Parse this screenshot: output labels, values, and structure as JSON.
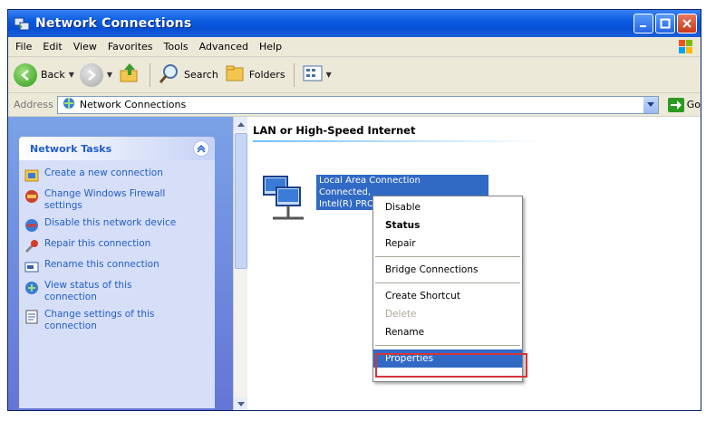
{
  "window": {
    "title": "Network Connections"
  },
  "menubar": {
    "items": [
      "File",
      "Edit",
      "View",
      "Favorites",
      "Tools",
      "Advanced",
      "Help"
    ]
  },
  "toolbar": {
    "back_label": "Back",
    "search_label": "Search",
    "folders_label": "Folders"
  },
  "addressbar": {
    "label": "Address",
    "value": "Network Connections",
    "go_label": "Go"
  },
  "tasks": {
    "title": "Network Tasks",
    "items": [
      {
        "label": "Create a new connection",
        "icon": "new-connection-icon"
      },
      {
        "label": "Change Windows Firewall settings",
        "icon": "firewall-icon"
      },
      {
        "label": "Disable this network device",
        "icon": "disable-device-icon"
      },
      {
        "label": "Repair this connection",
        "icon": "repair-icon"
      },
      {
        "label": "Rename this connection",
        "icon": "rename-icon"
      },
      {
        "label": "View status of this connection",
        "icon": "status-icon"
      },
      {
        "label": "Change settings of this connection",
        "icon": "settings-icon"
      }
    ]
  },
  "group": {
    "header": "LAN or High-Speed Internet"
  },
  "connection": {
    "name": "Local Area Connection",
    "status": "Connected,",
    "device": "Intel(R) PRO"
  },
  "context_menu": {
    "items": [
      {
        "label": "Disable",
        "style": "normal"
      },
      {
        "label": "Status",
        "style": "bold"
      },
      {
        "label": "Repair",
        "style": "normal"
      },
      {
        "label": "Bridge Connections",
        "style": "normal"
      },
      {
        "label": "Create Shortcut",
        "style": "normal"
      },
      {
        "label": "Delete",
        "style": "disabled"
      },
      {
        "label": "Rename",
        "style": "normal"
      },
      {
        "label": "Properties",
        "style": "selected"
      }
    ]
  },
  "colors": {
    "titlebar": "#0750d6",
    "task_link": "#215dc6",
    "selection": "#316ac5",
    "highlight_box": "#d6343b"
  }
}
